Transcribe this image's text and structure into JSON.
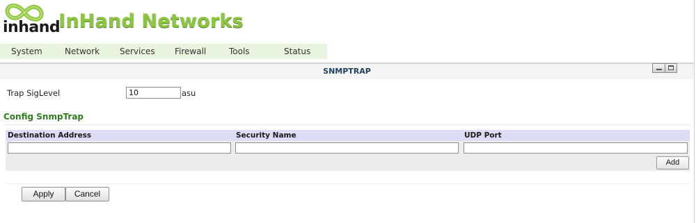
{
  "header": {
    "logo_text": "inhand",
    "brand_name": "InHand Networks"
  },
  "nav": {
    "items": [
      {
        "label": "System"
      },
      {
        "label": "Network"
      },
      {
        "label": "Services"
      },
      {
        "label": "Firewall"
      },
      {
        "label": "Tools"
      },
      {
        "label": "Status"
      }
    ]
  },
  "panel": {
    "title": "SNMPTRAP",
    "window_buttons": [
      "minimize-icon",
      "maximize-icon"
    ]
  },
  "trap_level": {
    "label": "Trap SigLevel",
    "value": "10",
    "unit": "asu"
  },
  "config": {
    "section_title": "Config SnmpTrap",
    "columns": [
      "Destination Address",
      "Security Name",
      "UDP Port"
    ],
    "new_row": {
      "destination_address": "",
      "security_name": "",
      "udp_port": ""
    },
    "add_label": "Add"
  },
  "actions": {
    "apply_label": "Apply",
    "cancel_label": "Cancel"
  },
  "colors": {
    "brand_green": "#8cc63f",
    "section_green": "#2e7d1e",
    "nav_background": "#e9f4de",
    "table_header_background": "#dcdcf6"
  }
}
